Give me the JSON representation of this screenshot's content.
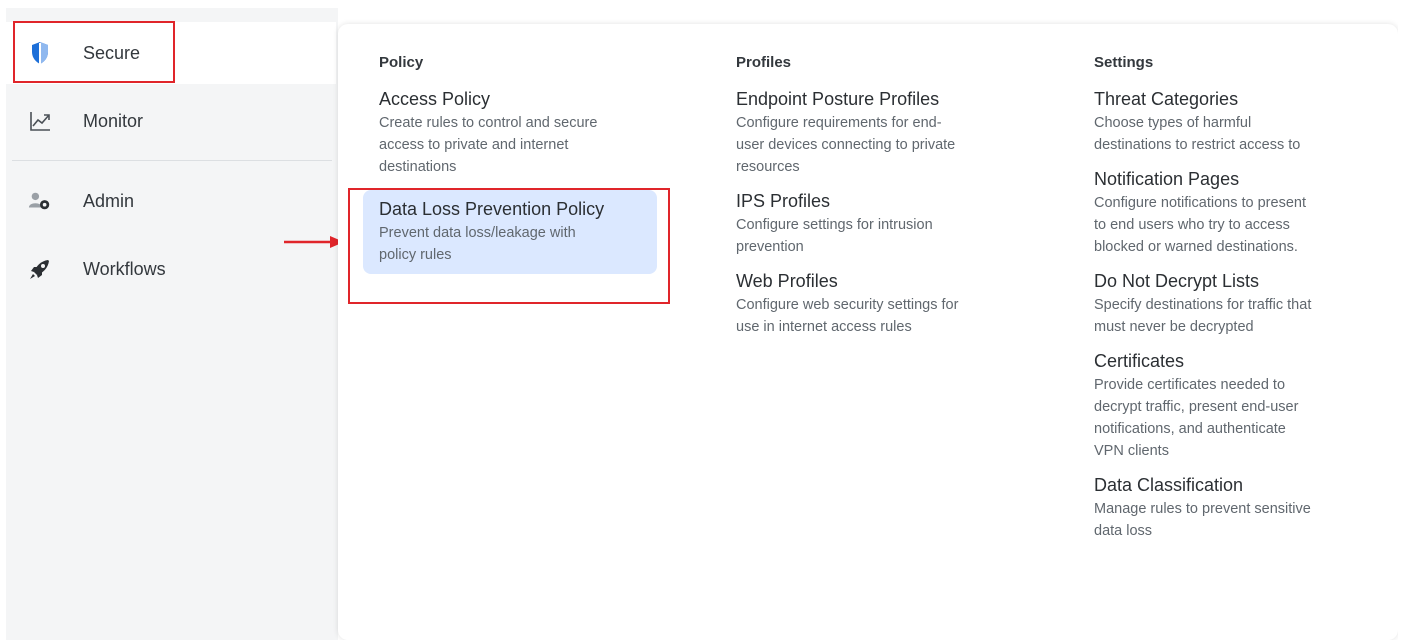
{
  "sidebar": {
    "items": [
      {
        "label": "Secure",
        "icon": "shield-icon",
        "active": true
      },
      {
        "label": "Monitor",
        "icon": "chart-line-icon",
        "active": false
      },
      {
        "label": "Admin",
        "icon": "admin-user-gear-icon",
        "active": false
      },
      {
        "label": "Workflows",
        "icon": "rocket-icon",
        "active": false
      }
    ]
  },
  "menu": {
    "policy": {
      "heading": "Policy",
      "entries": [
        {
          "title": "Access Policy",
          "desc": [
            "Create rules to control and secure",
            "access to private and internet",
            "destinations"
          ]
        },
        {
          "title": "Data Loss Prevention Policy",
          "desc": [
            "Prevent data loss/leakage with",
            "policy rules"
          ]
        }
      ]
    },
    "profiles": {
      "heading": "Profiles",
      "entries": [
        {
          "title": "Endpoint Posture Profiles",
          "desc": [
            "Configure requirements for end-",
            "user devices connecting to private",
            "resources"
          ]
        },
        {
          "title": "IPS Profiles",
          "desc": [
            "Configure settings for intrusion",
            "prevention"
          ]
        },
        {
          "title": "Web Profiles",
          "desc": [
            "Configure web security settings for",
            "use in internet access rules"
          ]
        }
      ]
    },
    "settings": {
      "heading": "Settings",
      "entries": [
        {
          "title": "Threat Categories",
          "desc": [
            "Choose types of harmful",
            "destinations to restrict access to"
          ]
        },
        {
          "title": "Notification Pages",
          "desc": [
            "Configure notifications to present",
            "to end users who try to access",
            "blocked or warned destinations."
          ]
        },
        {
          "title": "Do Not Decrypt Lists",
          "desc": [
            "Specify destinations for traffic that",
            "must never be decrypted"
          ]
        },
        {
          "title": "Certificates",
          "desc": [
            "Provide certificates needed to",
            "decrypt traffic, present end-user",
            "notifications, and authenticate",
            "VPN clients"
          ]
        },
        {
          "title": "Data Classification",
          "desc": [
            "Manage rules to prevent sensitive",
            "data loss"
          ]
        }
      ]
    }
  },
  "colors": {
    "accent_blue": "#1d6fd8",
    "highlight_red": "#e0252a",
    "selected_bg": "#dbe8ff"
  }
}
